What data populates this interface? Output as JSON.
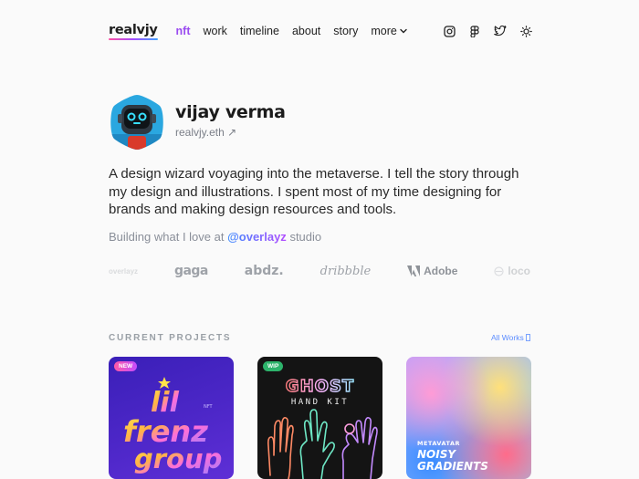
{
  "header": {
    "logo": "realvjy",
    "nav": [
      {
        "label": "nft",
        "active": true
      },
      {
        "label": "work",
        "active": false
      },
      {
        "label": "timeline",
        "active": false
      },
      {
        "label": "about",
        "active": false
      },
      {
        "label": "story",
        "active": false
      },
      {
        "label": "more",
        "active": false,
        "dropdown": true
      }
    ],
    "icons": [
      "instagram-icon",
      "figma-icon",
      "twitter-icon",
      "theme-toggle-icon"
    ]
  },
  "profile": {
    "name": "vijay verma",
    "handle": "realvjy.eth",
    "handle_arrow": "↗",
    "bio": "A design wizard voyaging into the metaverse. I tell the story through my design and illustrations. I spent most of my time designing for brands and making design resources and tools.",
    "building_prefix": "Building what I love at",
    "building_link": "@overlayz",
    "building_suffix": "studio"
  },
  "brands": [
    {
      "label": "overlayz",
      "name": "brand-logo-faded-left"
    },
    {
      "label": "gaga",
      "name": "brand-logo-gaga"
    },
    {
      "label": "abdz.",
      "name": "brand-logo-abdz"
    },
    {
      "label": "dribbble",
      "name": "brand-logo-dribbble"
    },
    {
      "label": "Adobe",
      "name": "brand-logo-adobe"
    },
    {
      "label": "loco",
      "name": "brand-logo-faded-right"
    }
  ],
  "projects": {
    "title": "CURRENT PROJECTS",
    "all_works": "All Works",
    "cards": [
      {
        "badge": "NEW",
        "line1": "lil",
        "line2": "frenz",
        "line3": "group",
        "tag": "NFT",
        "name": "card-lil-frenz"
      },
      {
        "badge": "WIP",
        "title": "GHOST",
        "subtitle": "HAND KIT",
        "name": "card-ghost-hand-kit"
      },
      {
        "brand": "METAVATAR",
        "title1": "NOISY",
        "title2": "GRADIENTS",
        "name": "card-noisy-gradients"
      }
    ]
  },
  "colors": {
    "accent_purple": "#9a4bf0",
    "link_blue": "#5b8cff",
    "badge_new": "#e14fb8",
    "badge_wip": "#2db36b"
  }
}
